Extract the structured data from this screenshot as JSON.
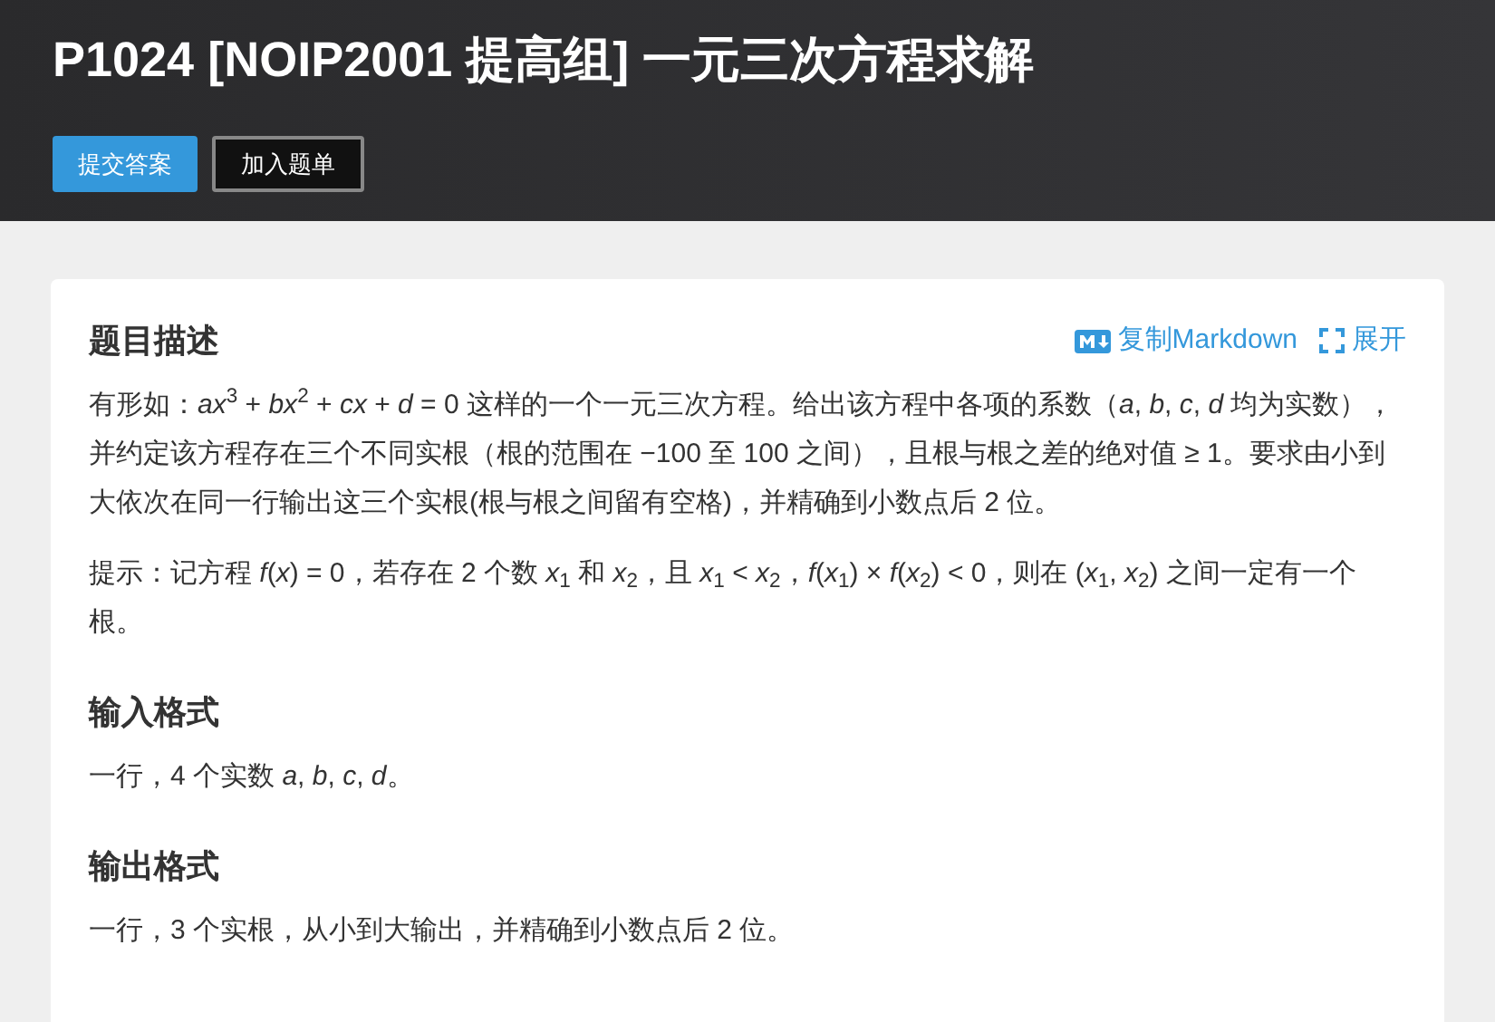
{
  "header": {
    "title": "P1024 [NOIP2001 提高组] 一元三次方程求解",
    "buttons": [
      {
        "label": "提交答案",
        "kind": "primary"
      },
      {
        "label": "加入题单",
        "kind": "secondary"
      }
    ]
  },
  "sections": [
    {
      "heading": "题目描述",
      "actions": [
        {
          "label": "复制Markdown",
          "kind": "markdown"
        },
        {
          "label": "展开",
          "kind": "expand"
        }
      ],
      "paragraphs": [
        "有形如：*ax*$^{3}$ + *bx*$^{2}$ + *cx* + *d* = 0 这样的一个一元三次方程。给出该方程中各项的系数（*a*, *b*, *c*, *d* 均为实数），并约定该方程存在三个不同实根（根的范围在 −100 至 100 之间），且根与根之差的绝对值 ≥ 1。要求由小到大依次在同一行输出这三个实根(根与根之间留有空格)，并精确到小数点后 2 位。",
        "提示：记方程 *f*(*x*) = 0，若存在 2 个数 *x*$_{1}$ 和 *x*$_{2}$，且 *x*$_{1}$ < *x*$_{2}$，*f*(*x*$_{1}$) × *f*(*x*$_{2}$) < 0，则在 (*x*$_{1}$, *x*$_{2}$) 之间一定有一个根。"
      ]
    },
    {
      "heading": "输入格式",
      "paragraphs": [
        "一行，4 个实数 *a*, *b*, *c*, *d*。"
      ]
    },
    {
      "heading": "输出格式",
      "paragraphs": [
        "一行，3 个实根，从小到大输出，并精确到小数点后 2 位。"
      ]
    }
  ]
}
